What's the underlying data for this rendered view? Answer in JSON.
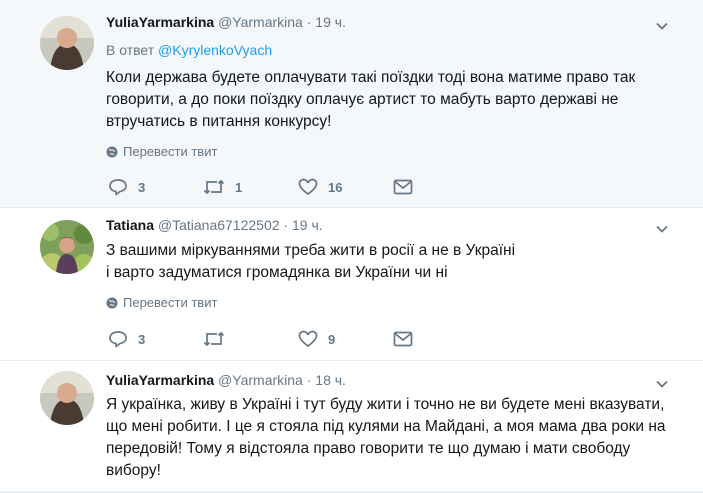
{
  "tweets": [
    {
      "name": "YuliaYarmarkina",
      "handle": "@Yarmarkina",
      "time": "19 ч.",
      "reply_prefix": "В ответ ",
      "reply_to": "@KyrylenkoVyach",
      "text": "Коли держава будете оплачувати такі поїздки тоді вона матиме право так говорити, а до поки поїздку оплачує артист то мабуть варто державі не втручатись в питання конкурсу!",
      "translate": "Перевести твит",
      "replies": "3",
      "retweets": "1",
      "likes": "16"
    },
    {
      "name": "Tatiana",
      "handle": "@Tatiana67122502",
      "time": "19 ч.",
      "text_line1": "З вашими міркуваннями треба жити в росії а не в Україні",
      "text_line2": "і варто задуматися громадянка ви України чи ні",
      "translate": "Перевести твит",
      "replies": "3",
      "likes": "9"
    },
    {
      "name": "YuliaYarmarkina",
      "handle": "@Yarmarkina",
      "time": "18 ч.",
      "text": "Я українка, живу в Україні і тут буду жити і точно не ви будете мені вказувати, що мені робити. І це я стояла під кулями на Майдані, а моя мама два роки на передовій! Тому я відстояла право говорити те що думаю і мати свободу вибору!"
    }
  ],
  "separator": "·",
  "colors": {
    "accent": "#1da1f2",
    "muted": "#657786",
    "highlight_bg": "#f5f8fa"
  }
}
